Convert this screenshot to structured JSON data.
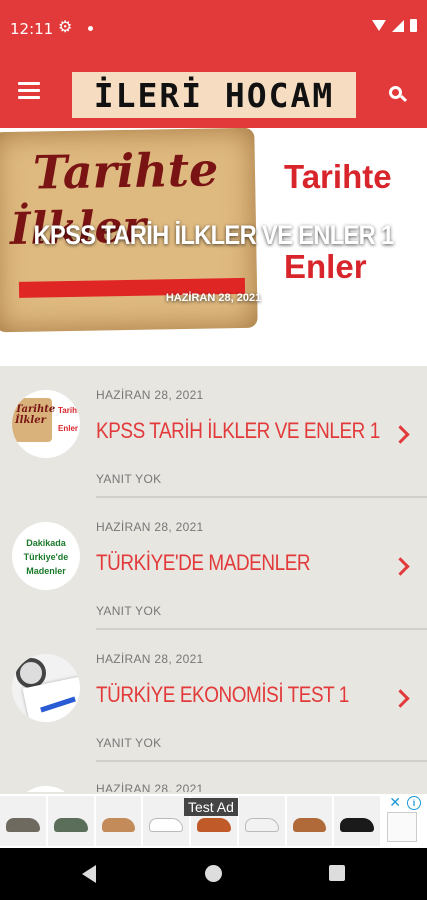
{
  "status_bar": {
    "time": "12:11",
    "icons": [
      "gear-icon",
      "dot-icon",
      "wifi-icon",
      "cell-signal-icon",
      "battery-icon"
    ]
  },
  "app_bar": {
    "logo_text": "İLERİ HOCAM",
    "left_icon": "hamburger-menu-icon",
    "right_icon": "search-icon",
    "color": "#e23a3a"
  },
  "hero": {
    "image_text_left_1": "Tarihte",
    "image_text_left_2": "İlkler",
    "image_text_right_1": "Tarihte",
    "image_text_right_2": "Enler",
    "title": "KPSS TARİH İLKLER VE ENLER 1",
    "date": "HAZİRAN 28, 2021"
  },
  "posts": [
    {
      "date": "HAZİRAN 28, 2021",
      "title": "KPSS TARİH İLKLER VE ENLER 1",
      "replies": "YANIT YOK",
      "thumb_text_1": "Tarihte İlkler",
      "thumb_text_2": "Tarihte",
      "thumb_text_3": "Enler"
    },
    {
      "date": "HAZİRAN 28, 2021",
      "title": "TÜRKİYE'DE MADENLER",
      "replies": "YANIT YOK",
      "thumb_text_1": "Dakikada Türkiye'de Madenler"
    },
    {
      "date": "HAZİRAN 28, 2021",
      "title": "TÜRKİYE EKONOMİSİ TEST 1",
      "replies": "YANIT YOK"
    },
    {
      "date": "HAZİRAN 28, 2021"
    }
  ],
  "ad": {
    "label": "Test Ad",
    "info_icon": "info-icon",
    "close_icon": "close-icon",
    "shoe_colors": [
      "#6f6a60",
      "#5a6e5a",
      "#c48b5a",
      "#ffffff",
      "#c05a28",
      "#f2f2f2",
      "#b06a3a",
      "#1a1a1a"
    ]
  },
  "nav_bar": {
    "back_icon": "back-icon",
    "home_icon": "home-icon",
    "recents_icon": "recents-icon"
  }
}
